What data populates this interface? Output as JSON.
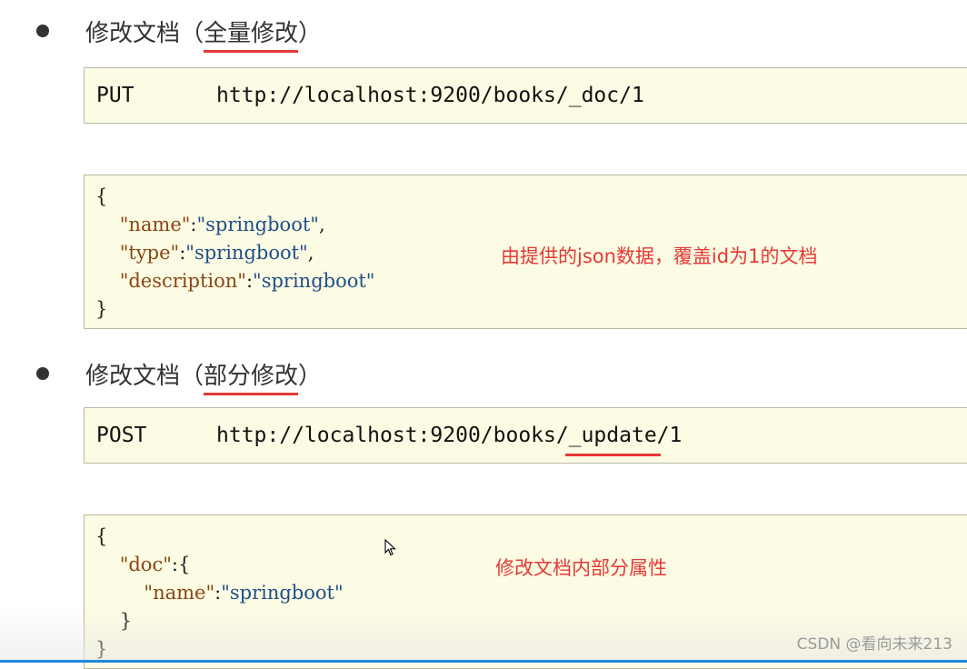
{
  "section1": {
    "heading_main": "修改文档",
    "paren_open": "（",
    "heading_sub": "全量修改",
    "paren_close": "）",
    "method": "PUT",
    "url": "http://localhost:9200/books/_doc/1",
    "json_lines": {
      "open": "{",
      "k1": "\"name\"",
      "v1": "\"springboot\"",
      "k2": "\"type\"",
      "v2": "\"springboot\"",
      "k3": "\"description\"",
      "v3": "\"springboot\"",
      "close": "}"
    },
    "annotation": "由提供的json数据，覆盖id为1的文档"
  },
  "section2": {
    "heading_main": "修改文档",
    "paren_open": "（",
    "heading_sub": "部分修改",
    "paren_close": "）",
    "method": "POST",
    "url_prefix": "http://localhost:9200/books/",
    "url_highlight": "_update",
    "url_suffix": "/1",
    "json_lines": {
      "open": "{",
      "k1": "\"doc\"",
      "k2": "\"name\"",
      "v2": "\"springboot\"",
      "inner_close": "}",
      "close": "}"
    },
    "annotation": "修改文档内部分属性"
  },
  "watermark": "CSDN @看向未来213",
  "colors": {
    "code_bg": "#fcfbe3",
    "underline_red": "#e53935",
    "json_key": "#8b4513",
    "json_string": "#1f4e8c",
    "bottom_bar": "#1e88e5"
  }
}
